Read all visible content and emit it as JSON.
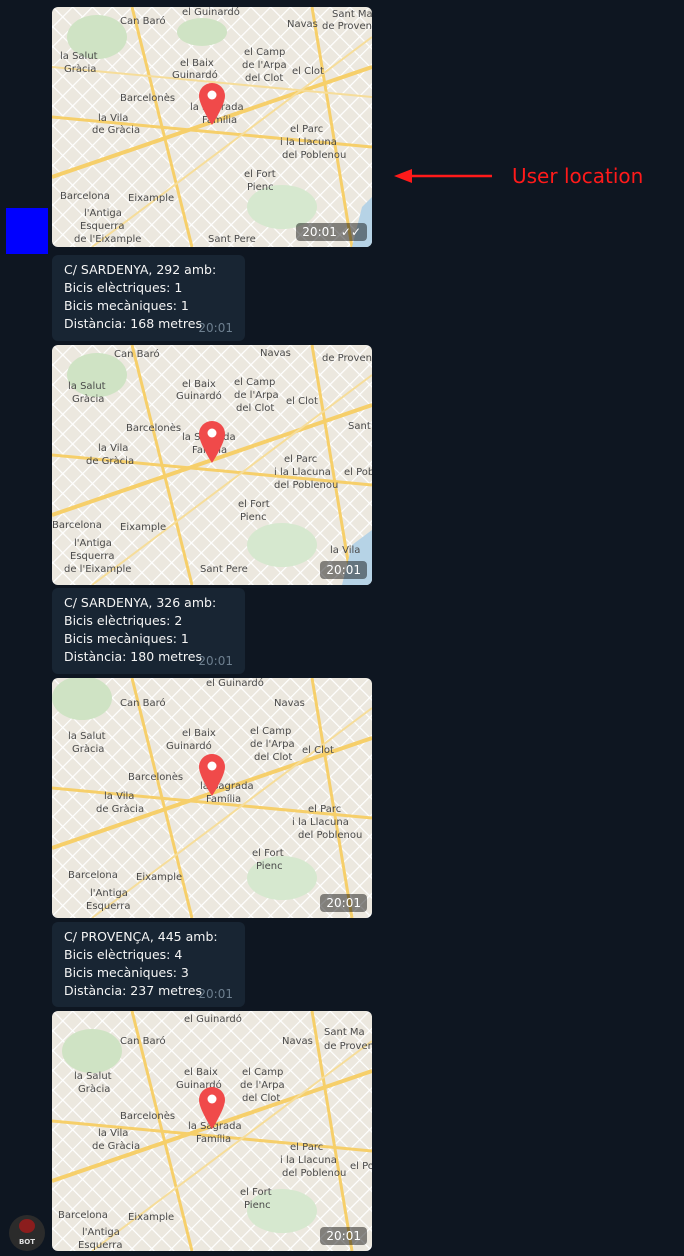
{
  "user_location_annotation": "User location",
  "map_labels": {
    "can_baro": "Can Baró",
    "el_guinardo": "el Guinardó",
    "la_salut": "la Salut",
    "gracia": "Gràcia",
    "el_baix_guinardo": "el Baix",
    "guinardo": "Guinardó",
    "el_camp": "el Camp",
    "de_larpa": "de l'Arpa",
    "del_clot": "del Clot",
    "el_clot": "el Clot",
    "navas": "Navas",
    "barcelones": "Barcelonès",
    "la_sagrada": "la Sagrada",
    "familia": "Família",
    "la_vila": "la Vila",
    "de_gracia": "de Gràcia",
    "el_parc": "el Parc",
    "la_llacuna": "i la Llacuna",
    "del_poblenou": "del Poblenou",
    "el_fort": "el Fort",
    "pienc": "Pienc",
    "barcelona": "Barcelona",
    "eixample": "Eixample",
    "lantiga": "l'Antiga",
    "esquerra": "Esquerra",
    "de_leixample": "de l'Eixample",
    "sant_pere": "Sant Pere",
    "sant_ma": "Sant Ma",
    "de_provenca": "de Provença",
    "sant": "Sant",
    "el_pobl": "el Pobl"
  },
  "messages": [
    {
      "type": "location",
      "time": "20:01",
      "read_checks": "✓✓"
    },
    {
      "type": "text",
      "lines": [
        "C/ SARDENYA, 292 amb:",
        "Bicis elèctriques: 1",
        "Bicis mecàniques: 1",
        "Distància: 168 metres"
      ],
      "time": "20:01"
    },
    {
      "type": "location",
      "time": "20:01"
    },
    {
      "type": "text",
      "lines": [
        "C/ SARDENYA, 326 amb:",
        "Bicis elèctriques: 2",
        "Bicis mecàniques: 1",
        "Distància: 180 metres"
      ],
      "time": "20:01"
    },
    {
      "type": "location",
      "time": "20:01"
    },
    {
      "type": "text",
      "lines": [
        "C/ PROVENÇA,  445 amb:",
        "Bicis elèctriques: 4",
        "Bicis mecàniques: 3",
        "Distància: 237 metres"
      ],
      "time": "20:01"
    },
    {
      "type": "location",
      "time": "20:01"
    }
  ],
  "avatar": {
    "label": "BOT"
  },
  "colors": {
    "background": "#0e1621",
    "bubble": "#182533",
    "pin": "#f04a4a",
    "annotation": "#ff1a1a",
    "marker_box": "#0000ff"
  }
}
